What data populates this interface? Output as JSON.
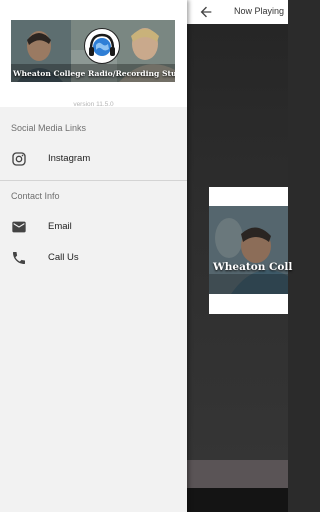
{
  "background_screen": {
    "title": "Now Playing",
    "card_caption": "Wheaton Coll"
  },
  "drawer": {
    "header_caption": "Wheaton College Radio/Recording Studio",
    "version": "version 11.5.0",
    "sections": [
      {
        "label": "Social Media Links",
        "items": [
          {
            "label": "Instagram",
            "icon": "instagram-icon"
          }
        ]
      },
      {
        "label": "Contact Info",
        "items": [
          {
            "label": "Email",
            "icon": "email-icon"
          },
          {
            "label": "Call Us",
            "icon": "phone-icon"
          }
        ]
      }
    ]
  },
  "colors": {
    "drawer_bg": "#f2f2f2",
    "header_bg": "#ffffff",
    "player_bar": "#5a5456",
    "logo_accent": "#2f7fd6"
  }
}
